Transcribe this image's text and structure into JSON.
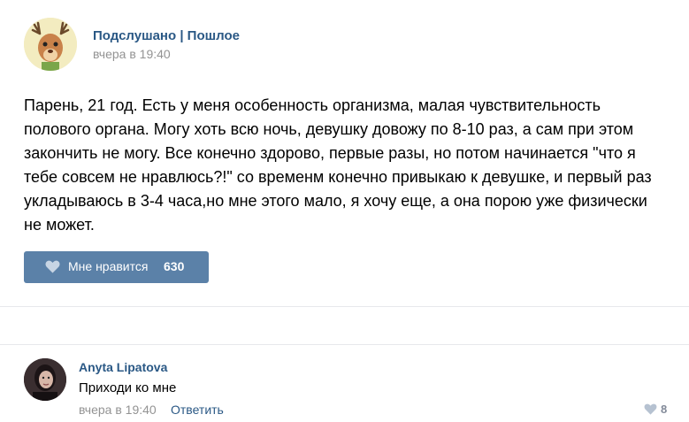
{
  "post": {
    "group_name": "Подслушано | Пошлое",
    "date": "вчера в 19:40",
    "avatar_icon": "deer-mascot-icon",
    "text_lines": [
      "Парень, 21 год. Есть у меня особенность организма, малая чувствительность",
      "полового органа. Могу хоть всю ночь, девушку довожу по 8-10 раз, а сам при этом",
      "закончить не могу. Все конечно здорово, первые разы, но потом начинается \"что я",
      "тебе совсем не нравлюсь?!\" со временм конечно привыкаю к девушке, и первый раз",
      "укладываюсь в 3-4 часа,но мне этого мало, я хочу еще, а она порою уже физически",
      "не может."
    ],
    "like_label": "Мне нравится",
    "like_count": "630"
  },
  "comment": {
    "author": "Anyta Lipatova",
    "text": "Приходи ко мне",
    "date": "вчера в 19:40",
    "reply_label": "Ответить",
    "like_count": "8"
  },
  "colors": {
    "link": "#2a5885",
    "like_button": "#5b81a8",
    "muted": "#939393"
  }
}
